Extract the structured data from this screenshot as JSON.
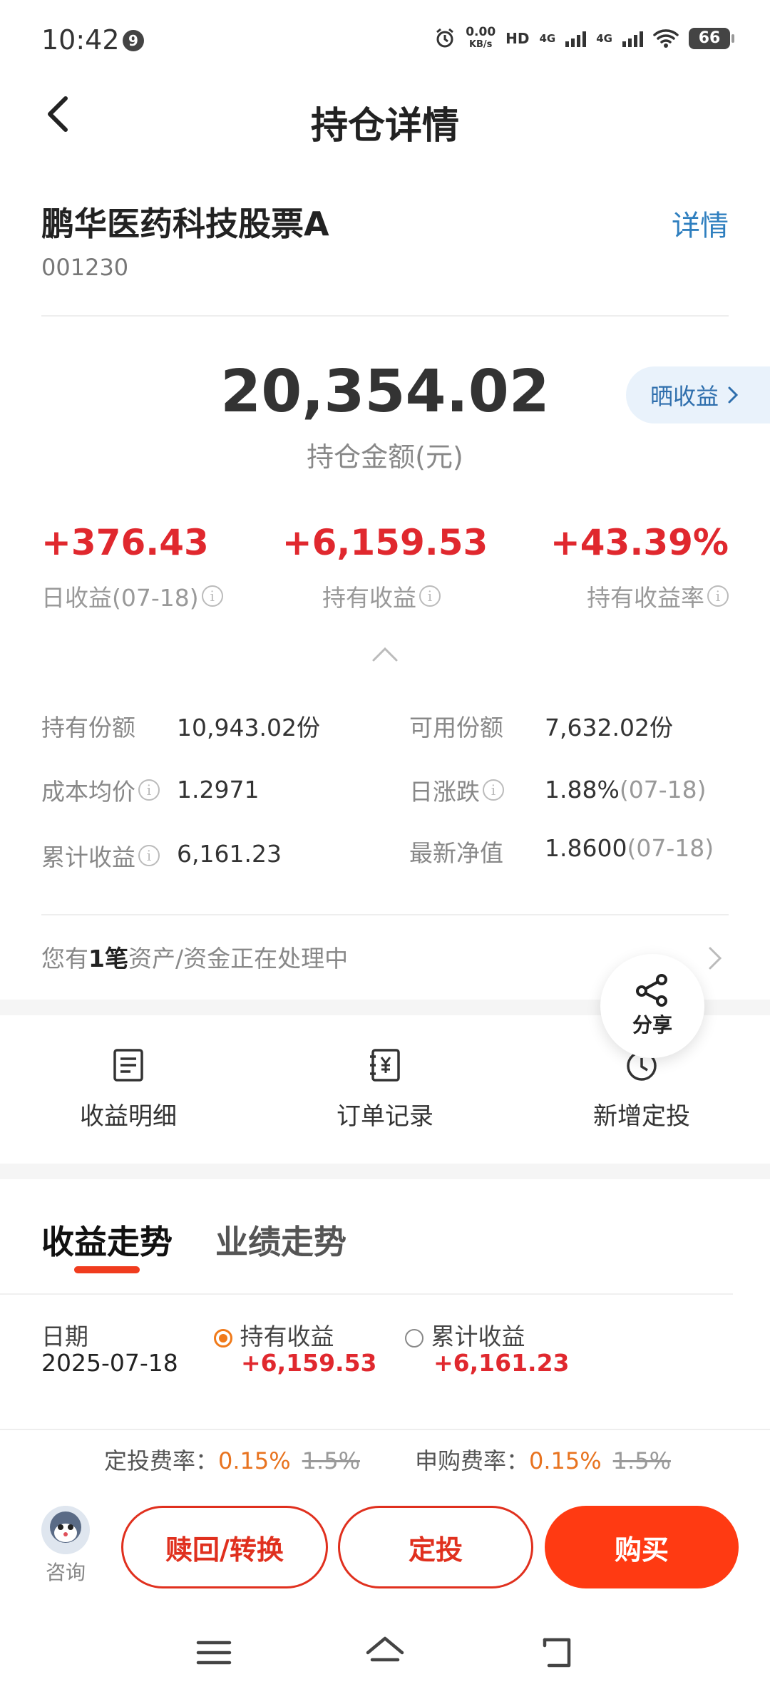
{
  "status_bar": {
    "time": "10:42",
    "notif_badge": "9",
    "net_speed_top": "0.00",
    "net_speed_bottom": "KB/s",
    "hd_label": "HD",
    "sim1": "4G",
    "sim2": "4G",
    "battery": "66"
  },
  "header": {
    "title": "持仓详情",
    "back_icon": "chevron-left-icon"
  },
  "fund": {
    "name": "鹏华医药科技股票A",
    "code": "001230",
    "detail_link": "详情"
  },
  "holding": {
    "amount": "20,354.02",
    "amount_label": "持仓金额(元)",
    "show_profit_button": "晒收益"
  },
  "metrics": [
    {
      "value": "+376.43",
      "label": "日收益(07-18)"
    },
    {
      "value": "+6,159.53",
      "label": "持有收益"
    },
    {
      "value": "+43.39%",
      "label": "持有收益率"
    }
  ],
  "details": {
    "left": [
      {
        "label": "持有份额",
        "value": "10,943.02份",
        "info": false
      },
      {
        "label": "成本均价",
        "value": "1.2971",
        "info": true
      },
      {
        "label": "累计收益",
        "value": "6,161.23",
        "info": true
      }
    ],
    "right": [
      {
        "label": "可用份额",
        "value": "7,632.02份",
        "sub": "",
        "info": false
      },
      {
        "label": "日涨跌",
        "value": "1.88%",
        "sub": "(07-18)",
        "info": true
      },
      {
        "label": "最新净值",
        "value": "1.8600",
        "sub": "(07-18)",
        "info": false
      }
    ]
  },
  "processing": {
    "prefix": "您有",
    "count": "1笔",
    "suffix": "资产/资金正在处理中"
  },
  "share": {
    "label": "分享",
    "icon": "share-icon"
  },
  "actions": [
    {
      "label": "收益明细",
      "icon": "document-list-icon"
    },
    {
      "label": "订单记录",
      "icon": "yen-receipt-icon"
    },
    {
      "label": "新增定投",
      "icon": "clock-icon"
    }
  ],
  "tabs": {
    "active": "收益走势",
    "inactive": "业绩走势"
  },
  "chart_header": {
    "date_label": "日期",
    "date_value": "2025-07-18",
    "series": [
      {
        "name": "持有收益",
        "value": "+6,159.53",
        "selected": true
      },
      {
        "name": "累计收益",
        "value": "+6,161.23",
        "selected": false
      }
    ]
  },
  "fees": {
    "sip_label": "定投费率：",
    "sip_rate": "0.15%",
    "sip_original": "1.5%",
    "purchase_label": "申购费率：",
    "purchase_rate": "0.15%",
    "purchase_original": "1.5%"
  },
  "bottom": {
    "consult_label": "咨询",
    "redeem_button": "赎回/转换",
    "sip_button": "定投",
    "buy_button": "购买"
  },
  "colors": {
    "red": "#e0282e",
    "accent": "#ff3a12",
    "link": "#2f7fbf",
    "fee": "#e8731f"
  }
}
